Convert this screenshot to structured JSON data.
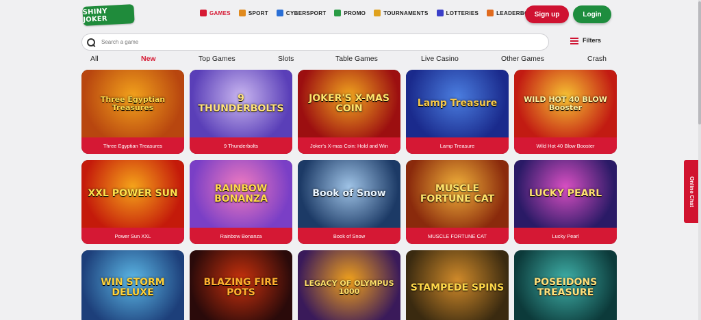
{
  "header": {
    "logo_text": "SHINY JOKER",
    "nav": [
      {
        "label": "GAMES",
        "icon": "games-icon",
        "color": "#d61a34",
        "active": true
      },
      {
        "label": "SPORT",
        "icon": "sport-icon",
        "color": "#e08a1e",
        "active": false
      },
      {
        "label": "CYBERSPORT",
        "icon": "cybersport-icon",
        "color": "#2a6fd6",
        "active": false
      },
      {
        "label": "PROMO",
        "icon": "promo-icon",
        "color": "#2a9c45",
        "active": false
      },
      {
        "label": "TOURNAMENTS",
        "icon": "tournaments-icon",
        "color": "#e0a21e",
        "active": false
      },
      {
        "label": "LOTTERIES",
        "icon": "lotteries-icon",
        "color": "#3b3fc9",
        "active": false
      },
      {
        "label": "LEADERBOARD",
        "icon": "leaderboard-icon",
        "color": "#e06a1e",
        "active": false
      }
    ],
    "signup_label": "Sign up",
    "login_label": "Login"
  },
  "search": {
    "placeholder": "Search a game",
    "filters_label": "Filters"
  },
  "tabs": [
    {
      "label": "All",
      "active": false
    },
    {
      "label": "New",
      "active": true
    },
    {
      "label": "Top Games",
      "active": false
    },
    {
      "label": "Slots",
      "active": false
    },
    {
      "label": "Table Games",
      "active": false
    },
    {
      "label": "Live Casino",
      "active": false
    },
    {
      "label": "Other Games",
      "active": false
    },
    {
      "label": "Crash",
      "active": false
    }
  ],
  "games": [
    {
      "art_title": "Three Egyptian Treasures",
      "label": "Three Egyptian Treasures",
      "bg": "#b8460f",
      "bg2": "#f2a21c",
      "fg": "#ffd84a"
    },
    {
      "art_title": "9 THUNDERBOLTS",
      "label": "9 Thunderbolts",
      "bg": "#5a3fb8",
      "bg2": "#c9b6f0",
      "fg": "#ffe27a"
    },
    {
      "art_title": "JOKER'S X-MAS COIN",
      "label": "Joker's X-mas Coin: Hold and Win",
      "bg": "#9c0f10",
      "bg2": "#f0a51f",
      "fg": "#ffe36a"
    },
    {
      "art_title": "Lamp Treasure",
      "label": "Lamp Treasure",
      "bg": "#1a2a8c",
      "bg2": "#4b7ee0",
      "fg": "#f6c94a"
    },
    {
      "art_title": "WILD HOT 40 BLOW Booster",
      "label": "Wild Hot 40 Blow Booster",
      "bg": "#c21b12",
      "bg2": "#f6c233",
      "fg": "#fff2a0"
    },
    {
      "art_title": "XXL POWER SUN",
      "label": "Power Sun XXL",
      "bg": "#c41a0a",
      "bg2": "#f5a41a",
      "fg": "#ffe14d"
    },
    {
      "art_title": "RAINBOW BONANZA",
      "label": "Rainbow Bonanza",
      "bg": "#7a3fc6",
      "bg2": "#f07ac0",
      "fg": "#ffd84a"
    },
    {
      "art_title": "Book of Snow",
      "label": "Book of Snow",
      "bg": "#1c3a66",
      "bg2": "#9fc3e6",
      "fg": "#e8f4ff"
    },
    {
      "art_title": "MUSCLE FORTUNE CAT",
      "label": "MUSCLE FORTUNE CAT",
      "bg": "#8a2a0c",
      "bg2": "#f0b13a",
      "fg": "#ffe36a"
    },
    {
      "art_title": "LUCKY PEARL",
      "label": "Lucky Pearl",
      "bg": "#2a1a66",
      "bg2": "#d84fc2",
      "fg": "#ffe070"
    },
    {
      "art_title": "WIN STORM DELUXE",
      "label": "",
      "bg": "#1d3f7a",
      "bg2": "#5cb8e6",
      "fg": "#ffd23a"
    },
    {
      "art_title": "BLAZING FIRE POTS",
      "label": "",
      "bg": "#2a0a0a",
      "bg2": "#c8310d",
      "fg": "#ffb02e"
    },
    {
      "art_title": "LEGACY OF OLYMPUS 1000",
      "label": "",
      "bg": "#3a1a5a",
      "bg2": "#f0a11c",
      "fg": "#ffe06a"
    },
    {
      "art_title": "STAMPEDE SPINS",
      "label": "",
      "bg": "#3a2a10",
      "bg2": "#d08a2a",
      "fg": "#ffd84a"
    },
    {
      "art_title": "POSEIDONS TREASURE",
      "label": "",
      "bg": "#0c3a3a",
      "bg2": "#3fb0a8",
      "fg": "#ffe07a"
    }
  ],
  "chat_label": "Online Chat"
}
